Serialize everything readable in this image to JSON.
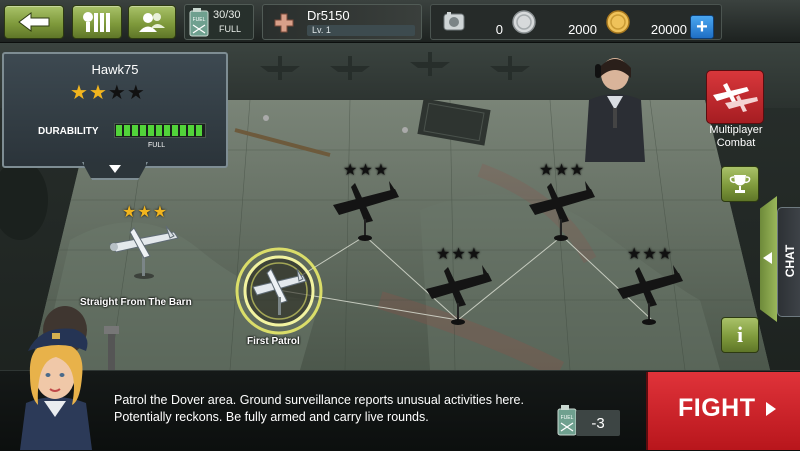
{
  "top_bar": {
    "fuel": {
      "icon": "fuel-can-icon",
      "value": "30/30",
      "state": "FULL"
    },
    "player": {
      "name": "Dr5150",
      "level": "Lv. 1"
    },
    "currencies": [
      {
        "icon": "parts-icon",
        "value": "0"
      },
      {
        "icon": "silver-coin-icon",
        "value": "2000"
      },
      {
        "icon": "gold-coin-icon",
        "value": "20000"
      }
    ],
    "add_label": "+"
  },
  "plane_panel": {
    "name": "Hawk75",
    "stars_filled": 2,
    "stars_total": 4,
    "durability_label": "DURABILITY",
    "durability_state": "FULL",
    "durability_fraction": 1.0
  },
  "side": {
    "multiplayer_label": "Multiplayer Combat",
    "chat_label": "CHAT",
    "info_label": "i"
  },
  "missions": [
    {
      "label": "Straight From The Barn",
      "state": "completed",
      "stars": 3
    },
    {
      "label": "First Patrol",
      "state": "selected",
      "stars": 0
    },
    {
      "label": "",
      "state": "locked",
      "stars": 3
    },
    {
      "label": "",
      "state": "locked",
      "stars": 3
    },
    {
      "label": "",
      "state": "locked",
      "stars": 3
    },
    {
      "label": "",
      "state": "locked",
      "stars": 3
    }
  ],
  "bottom": {
    "description": "Patrol the Dover area. Ground surveillance reports unusual activities here. Potentially reckons. Be fully armed and carry live rounds.",
    "fuel_cost": "-3",
    "fight_label": "FIGHT"
  },
  "colors": {
    "accent_green": "#7f9a3c",
    "fight_red": "#c81f26",
    "star_gold": "#f2b51e",
    "durability_green": "#52d43a"
  }
}
